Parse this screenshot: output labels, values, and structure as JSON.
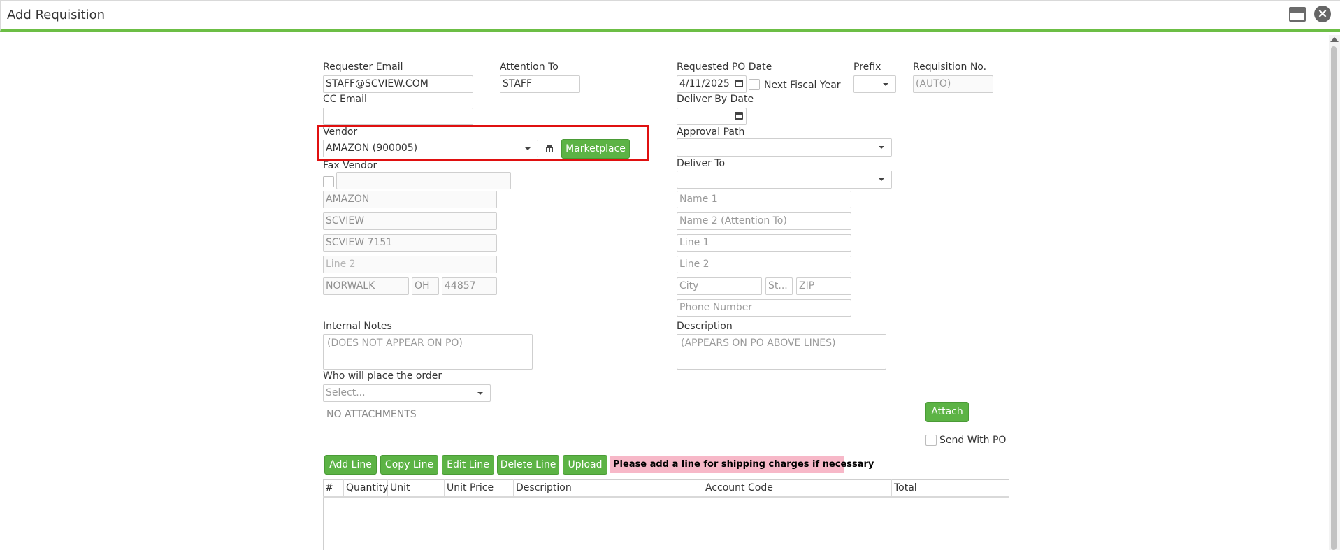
{
  "window": {
    "title": "Add Requisition"
  },
  "requester_email": {
    "label": "Requester Email",
    "value": "STAFF@SCVIEW.COM"
  },
  "attention_to": {
    "label": "Attention To",
    "value": "STAFF"
  },
  "requested_po_date": {
    "label": "Requested PO Date",
    "value": "4/11/2025"
  },
  "next_fiscal_year": {
    "label": "Next Fiscal Year"
  },
  "prefix": {
    "label": "Prefix",
    "value": ""
  },
  "requisition_no": {
    "label": "Requisition No.",
    "placeholder": "(AUTO)"
  },
  "cc_email": {
    "label": "CC Email",
    "value": ""
  },
  "deliver_by_date": {
    "label": "Deliver By Date",
    "value": ""
  },
  "vendor": {
    "label": "Vendor",
    "value": "AMAZON (900005)",
    "marketplace_label": "Marketplace"
  },
  "approval_path": {
    "label": "Approval Path",
    "value": ""
  },
  "fax_vendor": {
    "label": "Fax Vendor",
    "value": ""
  },
  "deliver_to": {
    "label": "Deliver To",
    "value": ""
  },
  "vendor_address": {
    "name": "AMAZON",
    "name2": "SCVIEW",
    "line1": "SCVIEW 7151",
    "line2_placeholder": "Line 2",
    "city": "NORWALK",
    "state": "OH",
    "zip": "44857"
  },
  "delivery_address": {
    "name1_placeholder": "Name 1",
    "name2_placeholder": "Name 2 (Attention To)",
    "line1_placeholder": "Line 1",
    "line2_placeholder": "Line 2",
    "city_placeholder": "City",
    "state_placeholder": "St...",
    "zip_placeholder": "ZIP",
    "phone_placeholder": "Phone Number"
  },
  "internal_notes": {
    "label": "Internal Notes",
    "placeholder": "(DOES NOT APPEAR ON PO)"
  },
  "description": {
    "label": "Description",
    "placeholder": "(APPEARS ON PO ABOVE LINES)"
  },
  "who_places_order": {
    "label": "Who will place the order",
    "placeholder": "Select..."
  },
  "attachments": {
    "empty_text": "NO ATTACHMENTS",
    "attach_label": "Attach",
    "send_with_po_label": "Send With PO"
  },
  "line_actions": {
    "add": "Add Line",
    "copy": "Copy Line",
    "edit": "Edit Line",
    "delete": "Delete Line",
    "upload": "Upload",
    "notice": "Please add a line for shipping charges if necessary"
  },
  "lines_grid": {
    "columns": [
      "#",
      "Quantity",
      "Unit",
      "Unit Price",
      "Description",
      "Account Code",
      "Total"
    ],
    "rows": []
  },
  "colors": {
    "accent": "#5cb345",
    "highlight": "#e01010",
    "notice_bg": "#f7b8c8"
  }
}
